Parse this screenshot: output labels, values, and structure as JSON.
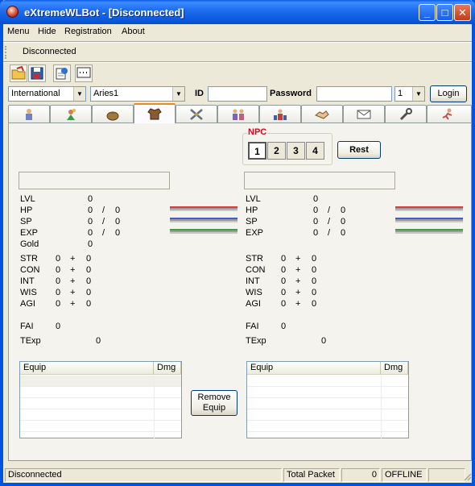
{
  "window": {
    "title": "eXtremeWLBot - [Disconnected]"
  },
  "menu": [
    "Menu",
    "Hide",
    "Registration",
    "About"
  ],
  "top_status": "Disconnected",
  "login": {
    "server": "International",
    "server_name": "Aries1",
    "id_label": "ID",
    "id_value": "",
    "password_label": "Password",
    "password_value": "",
    "slot": "1",
    "login_button": "Login"
  },
  "tabs": [
    "character-icon",
    "pet-icon",
    "bag-icon",
    "armor-icon",
    "battle-icon",
    "party-icon",
    "team-icon",
    "trade-icon",
    "mail-icon",
    "tool-icon",
    "run-icon"
  ],
  "npc": {
    "label": "NPC",
    "buttons": [
      "1",
      "2",
      "3",
      "4"
    ],
    "selected": "1",
    "rest_button": "Rest"
  },
  "player": {
    "lvl": "0",
    "hp": "0",
    "hp_max": "0",
    "sp": "0",
    "sp_max": "0",
    "exp": "0",
    "exp_max": "0",
    "gold": "0",
    "str_a": "0",
    "str_b": "0",
    "con_a": "0",
    "con_b": "0",
    "int_a": "0",
    "int_b": "0",
    "wis_a": "0",
    "wis_b": "0",
    "agi_a": "0",
    "agi_b": "0",
    "fai": "0",
    "texp": "0"
  },
  "pet": {
    "lvl": "0",
    "hp": "0",
    "hp_max": "0",
    "sp": "0",
    "sp_max": "0",
    "exp": "0",
    "exp_max": "0",
    "str_a": "0",
    "str_b": "0",
    "con_a": "0",
    "con_b": "0",
    "int_a": "0",
    "int_b": "0",
    "wis_a": "0",
    "wis_b": "0",
    "agi_a": "0",
    "agi_b": "0",
    "fai": "0",
    "texp": "0"
  },
  "labels": {
    "lvl": "LVL",
    "hp": "HP",
    "sp": "SP",
    "exp": "EXP",
    "gold": "Gold",
    "str": "STR",
    "con": "CON",
    "int": "INT",
    "wis": "WIS",
    "agi": "AGI",
    "fai": "FAI",
    "texp": "TExp",
    "slash": "/",
    "plus": "+"
  },
  "equip": {
    "col_equip": "Equip",
    "col_dmg": "Dmg",
    "remove_button": "Remove Equip"
  },
  "statusbar": {
    "status": "Disconnected",
    "total_packet_label": "Total Packet",
    "total_packet": "0",
    "mode": "OFFLINE"
  },
  "colors": {
    "hp_bar": "#d04040",
    "sp_bar": "#4060d0",
    "exp_bar": "#40a040",
    "tab_accent": "#e68b2c",
    "npc_label": "#e0001a"
  }
}
